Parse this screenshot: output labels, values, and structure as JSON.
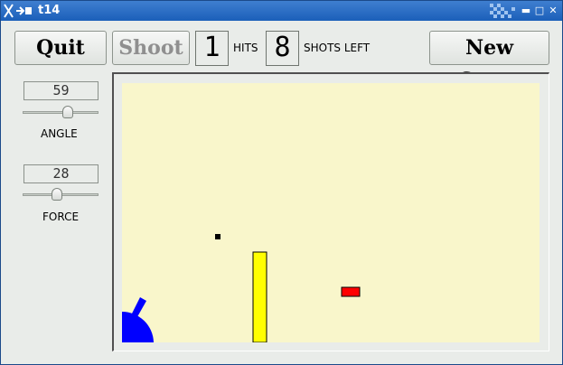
{
  "window": {
    "title": "t14"
  },
  "toolbar": {
    "quit_label": "Quit",
    "shoot_label": "Shoot",
    "new_game_label": "New Game"
  },
  "counters": {
    "hits_value": "1",
    "hits_label": "HITS",
    "shots_left_value": "8",
    "shots_left_label": "SHOTS LEFT"
  },
  "controls": {
    "angle_value": "59",
    "angle_label": "ANGLE",
    "angle_slider_fraction": 0.59,
    "force_value": "28",
    "force_label": "FORCE",
    "force_slider_fraction": 0.36
  },
  "colors": {
    "field_background": "#f9f6cb",
    "cannon": "#0000ff",
    "barrier": "#ffff00",
    "target": "#ff0000",
    "shot": "#000000"
  }
}
